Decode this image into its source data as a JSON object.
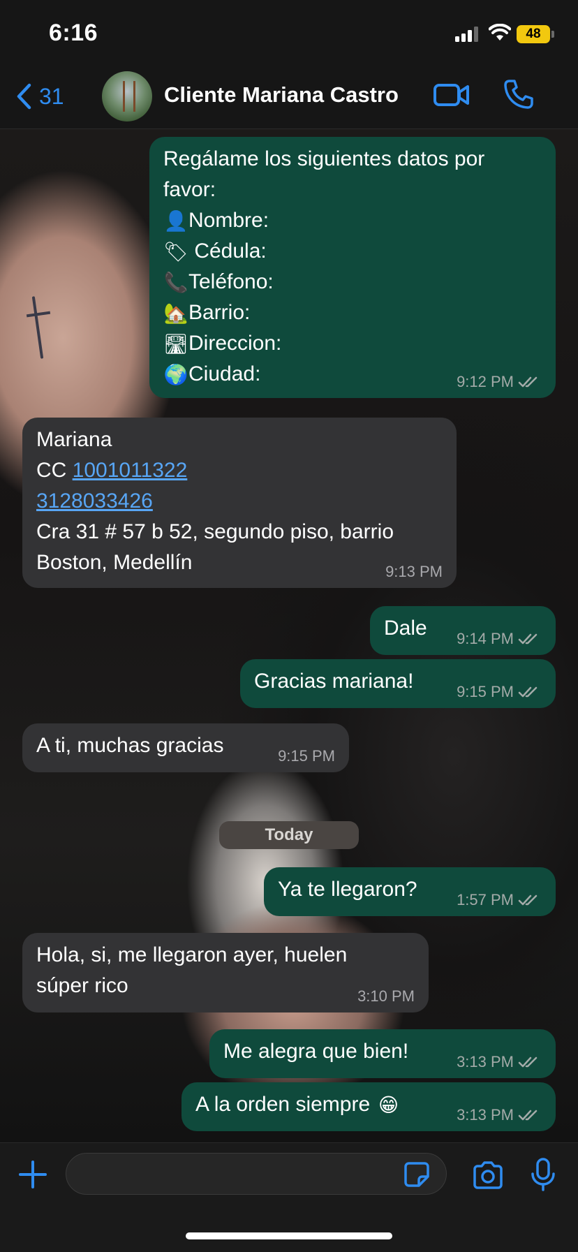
{
  "status_bar": {
    "time": "6:16",
    "battery": "48"
  },
  "header": {
    "back_count": "31",
    "contact_name": "Cliente Mariana Castro"
  },
  "messages": [
    {
      "direction": "out",
      "lines": [
        {
          "text": "Regálame los siguientes datos por"
        },
        {
          "text": "favor:"
        },
        {
          "emoji": "👤",
          "text": "Nombre:"
        },
        {
          "emoji": "🏷",
          "text": " Cédula:"
        },
        {
          "emoji": "📞",
          "text": "Teléfono:"
        },
        {
          "emoji": "🏡",
          "text": "Barrio:"
        },
        {
          "emoji": "🛣",
          "text": "Direccion:"
        },
        {
          "emoji": "🌍",
          "text": "Ciudad:"
        }
      ],
      "time": "9:12 PM",
      "read": true
    },
    {
      "direction": "in",
      "lines": [
        {
          "text": "Mariana"
        },
        {
          "prefix": "CC ",
          "link": "1001011322"
        },
        {
          "link": "3128033426"
        },
        {
          "text": "Cra 31 # 57 b 52, segundo piso, barrio"
        },
        {
          "text": "Boston, Medellín"
        }
      ],
      "time": "9:13 PM"
    },
    {
      "direction": "out",
      "text": "Dale",
      "time": "9:14 PM",
      "read": true
    },
    {
      "direction": "out",
      "text": "Gracias mariana!",
      "time": "9:15 PM",
      "read": true
    },
    {
      "direction": "in",
      "text": "A ti, muchas gracias",
      "time": "9:15 PM"
    },
    {
      "direction": "out",
      "text": "Ya te llegaron?",
      "time": "1:57 PM",
      "read": true
    },
    {
      "direction": "in",
      "lines": [
        {
          "text": "Hola, si, me llegaron ayer, huelen"
        },
        {
          "text": "súper rico"
        }
      ],
      "time": "3:10 PM"
    },
    {
      "direction": "out",
      "text": "Me alegra que bien!",
      "time": "3:13 PM",
      "read": true
    },
    {
      "direction": "out",
      "text": "A la orden siempre",
      "emoji_after": "😁",
      "time": "3:13 PM",
      "read": true
    }
  ],
  "date_separator": "Today",
  "input": {
    "value": "",
    "placeholder": ""
  },
  "colors": {
    "outgoing_bubble": "#0f4a3c",
    "incoming_bubble": "#333335",
    "accent": "#2f8cf0",
    "battery": "#f2c80f",
    "link": "#58a6f5"
  },
  "icons": [
    "back-chevron-icon",
    "video-call-icon",
    "phone-icon",
    "plus-icon",
    "sticker-icon",
    "camera-icon",
    "microphone-icon",
    "read-ticks-icon"
  ]
}
